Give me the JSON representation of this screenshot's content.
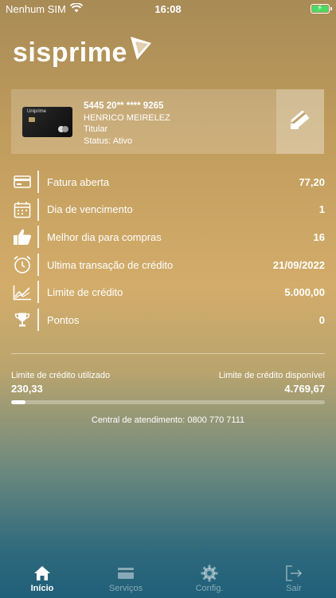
{
  "status_bar": {
    "carrier": "Nenhum SIM",
    "time": "16:08"
  },
  "logo": {
    "text": "sisprime"
  },
  "card": {
    "image_brand": "Uniprime",
    "number": "5445 20** **** 9265",
    "holder": "HENRICO MEIRELEZ",
    "type": "Titular",
    "status": "Status: Ativo"
  },
  "rows": [
    {
      "icon": "card-icon",
      "label": "Fatura aberta",
      "value": "77,20"
    },
    {
      "icon": "calendar-icon",
      "label": "Dia de vencimento",
      "value": "1"
    },
    {
      "icon": "thumbs-up-icon",
      "label": "Melhor dia para compras",
      "value": "16"
    },
    {
      "icon": "alarm-clock-icon",
      "label": "Ultima transação de crédito",
      "value": "21/09/2022"
    },
    {
      "icon": "chart-icon",
      "label": "Limite de crédito",
      "value": "5.000,00"
    },
    {
      "icon": "trophy-icon",
      "label": "Pontos",
      "value": "0"
    }
  ],
  "limits": {
    "used_label": "Limite de crédito utilizado",
    "used_value": "230,33",
    "available_label": "Limite de crédito disponível",
    "available_value": "4.769,67",
    "used_fraction": 0.046
  },
  "support": {
    "text": "Central de atendimento: 0800 770 7111"
  },
  "tabs": [
    {
      "label": "Início",
      "icon": "home-icon",
      "active": true
    },
    {
      "label": "Serviços",
      "icon": "card-icon",
      "active": false
    },
    {
      "label": "Config.",
      "icon": "gear-icon",
      "active": false
    },
    {
      "label": "Sair",
      "icon": "logout-icon",
      "active": false
    }
  ]
}
